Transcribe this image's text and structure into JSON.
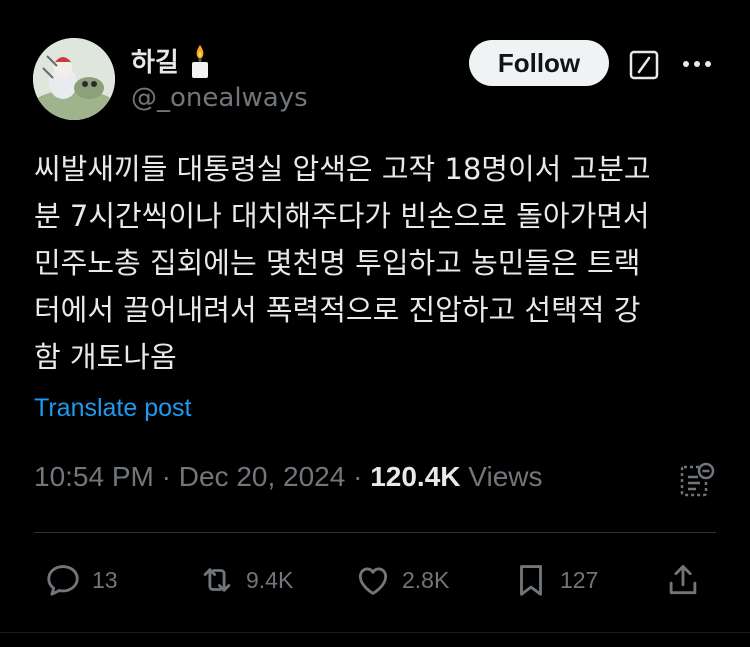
{
  "author": {
    "display_name": "하길",
    "handle": "@_onealways",
    "badge_icon": "candle-icon"
  },
  "header": {
    "follow_label": "Follow",
    "grok_icon": "grok-icon",
    "more_icon": "more-icon"
  },
  "tweet": {
    "lines": [
      "씨발새끼들 대통령실 압색은 고작 18명이서 고분고",
      "분 7시간씩이나 대치해주다가 빈손으로 돌아가면서",
      "민주노총 집회에는 몇천명 투입하고 농민들은 트랙",
      "터에서 끌어내려서 폭력적으로 진압하고 선택적 강",
      "함 개토나옴"
    ],
    "translate_label": "Translate post"
  },
  "meta": {
    "time": "10:54 PM",
    "separator": " · ",
    "date": "Dec 20, 2024",
    "views_count": "120.4K",
    "views_label": "Views"
  },
  "actions": {
    "replies": "13",
    "reposts": "9.4K",
    "likes": "2.8K",
    "bookmarks": "127"
  },
  "colors": {
    "background": "#000000",
    "text": "#e7e9ea",
    "muted": "#71767b",
    "link": "#1d9bf0",
    "follow_bg": "#eff3f4"
  }
}
